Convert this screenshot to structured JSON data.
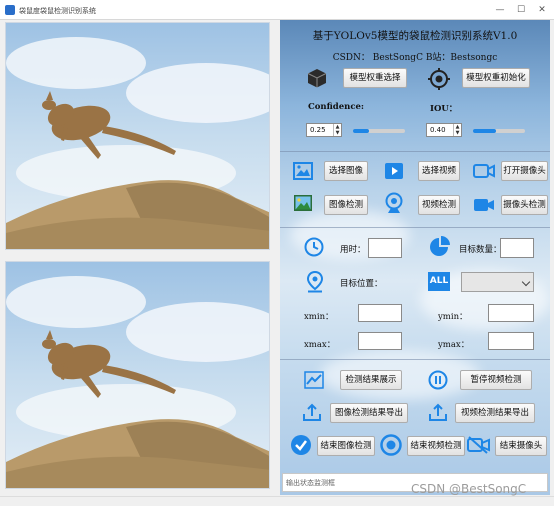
{
  "window": {
    "title": "袋鼠度袋鼠检测识别系统",
    "minimize_glyph": "—",
    "maximize_glyph": "☐",
    "close_glyph": "✕"
  },
  "header": {
    "title": "基于YOLOv5模型的袋鼠检测识别系统V1.0",
    "subtitle": "CSDN：  BestSongC    B站：Bestsongc"
  },
  "model": {
    "select_label": "模型权重选择",
    "init_label": "模型权重初始化",
    "confidence_label": "Confidence:",
    "confidence_value": "0.25",
    "confidence_level": 0.3,
    "iou_label": "IOU：",
    "iou_value": "0.40",
    "iou_level": 0.45
  },
  "input": {
    "select_image": "选择图像",
    "select_video": "选择视频",
    "open_camera": "打开摄像头",
    "image_detect": "图像检测",
    "video_detect": "视频检测",
    "camera_detect": "摄像头检测"
  },
  "results": {
    "time_label": "用时：",
    "count_label": "目标数量：",
    "position_label": "目标位置：",
    "xmin_label": "xmin：",
    "ymin_label": "ymin：",
    "xmax_label": "xmax：",
    "ymax_label": "ymax：",
    "all_badge": "ALL"
  },
  "actions": {
    "show_results": "检测结果展示",
    "pause_video": "暂停视频检测",
    "export_image": "图像检测结果导出",
    "export_video": "视频检测结果导出",
    "end_image": "结束图像检测",
    "end_video": "结束视频检测",
    "end_camera": "结束摄像头"
  },
  "status": {
    "placeholder": "输出状态监测框"
  },
  "watermark": "CSDN @BestSongC",
  "colors": {
    "accent": "#1e86e6",
    "sky": "#8cb5dc"
  }
}
